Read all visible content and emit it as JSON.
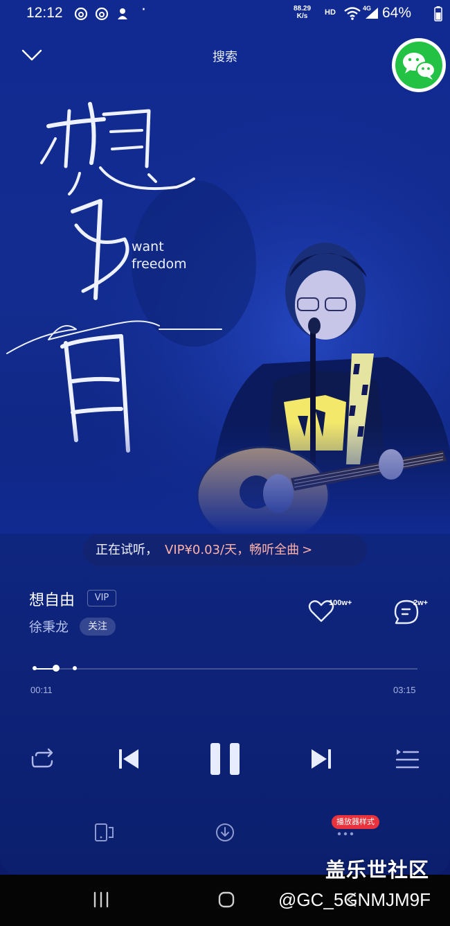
{
  "status_bar": {
    "time": "12:12",
    "net_speed_value": "88.29",
    "net_speed_unit": "K/s",
    "hd_label": "HD",
    "lte_label": "4G",
    "battery": "64%"
  },
  "header": {
    "search_label": "搜索"
  },
  "album": {
    "subtitle_line1": "want",
    "subtitle_line2": "freedom",
    "calligraphy_text": "想自由",
    "script_text": "freedom"
  },
  "trial_banner": {
    "text": "正在试听，",
    "offer": "VIP¥0.03/天，畅听全曲",
    "chevron": ">"
  },
  "song": {
    "title": "想自由",
    "vip_tag": "VIP",
    "artist": "徐秉龙",
    "follow_label": "关注",
    "like_count": "100w+",
    "comment_count": "2w+"
  },
  "progress": {
    "current_time": "00:11",
    "total_time": "03:15",
    "played_fraction": 0.056,
    "buffered_fraction": 0.104
  },
  "toolbar": {
    "player_style_badge": "播放器样式"
  },
  "watermark": {
    "title": "盖乐世社区",
    "user": "@GC_5GNMJM9F"
  },
  "colors": {
    "background": "#112a92",
    "accent_offer": "#ffb2a8",
    "wechat_green": "#23c244",
    "badge_red": "#e8323c"
  },
  "icons": {
    "collapse": "chevron-down-icon",
    "share": "wechat-icon",
    "like": "heart-icon",
    "comment": "comment-icon",
    "repeat": "repeat-icon",
    "previous": "skip-previous-icon",
    "pause": "pause-icon",
    "next": "skip-next-icon",
    "playlist": "playlist-icon",
    "device": "device-icon",
    "download": "download-icon",
    "more": "more-icon"
  }
}
